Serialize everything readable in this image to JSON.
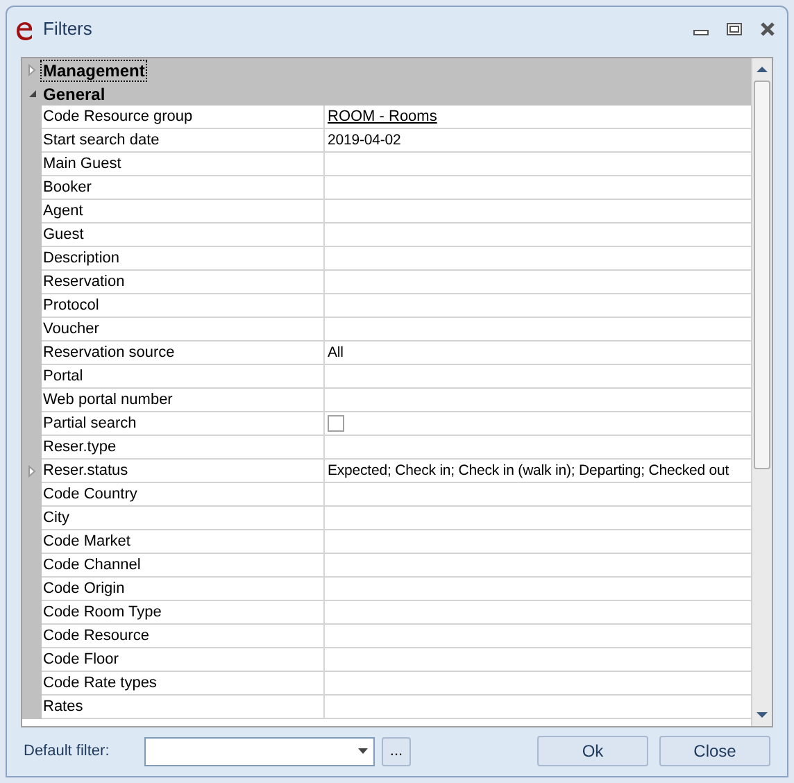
{
  "window": {
    "title": "Filters"
  },
  "groups": [
    {
      "label": "Management",
      "expanded": false,
      "focused": true
    },
    {
      "label": "General",
      "expanded": true,
      "focused": false
    }
  ],
  "rows": [
    {
      "label": "Code Resource group",
      "kind": "link",
      "value": "ROOM - Rooms"
    },
    {
      "label": "Start search date",
      "kind": "text",
      "value": "2019-04-02"
    },
    {
      "label": "Main Guest",
      "kind": "text"
    },
    {
      "label": "Booker",
      "kind": "text"
    },
    {
      "label": "Agent",
      "kind": "text"
    },
    {
      "label": "Guest",
      "kind": "text"
    },
    {
      "label": "Description",
      "kind": "text"
    },
    {
      "label": "Reservation",
      "kind": "text"
    },
    {
      "label": "Protocol",
      "kind": "text"
    },
    {
      "label": "Voucher",
      "kind": "text"
    },
    {
      "label": "Reservation source",
      "kind": "text",
      "value": "All"
    },
    {
      "label": "Portal",
      "kind": "text"
    },
    {
      "label": "Web portal number",
      "kind": "text"
    },
    {
      "label": "Partial search",
      "kind": "checkbox",
      "checked": false
    },
    {
      "label": "Reser.type",
      "kind": "text"
    },
    {
      "label": "Reser.status",
      "kind": "expander",
      "expanded": false,
      "value": "Expected; Check in; Check in (walk in); Departing; Checked out"
    },
    {
      "label": "Code Country",
      "kind": "text"
    },
    {
      "label": "City",
      "kind": "text"
    },
    {
      "label": "Code Market",
      "kind": "text"
    },
    {
      "label": "Code Channel",
      "kind": "text"
    },
    {
      "label": "Code Origin",
      "kind": "text"
    },
    {
      "label": "Code Room Type",
      "kind": "text"
    },
    {
      "label": "Code Resource",
      "kind": "text"
    },
    {
      "label": "Code Floor",
      "kind": "text"
    },
    {
      "label": "Code Rate types",
      "kind": "text"
    },
    {
      "label": "Rates",
      "kind": "text"
    }
  ],
  "footer": {
    "label": "Default filter:",
    "ellipsis": "...",
    "buttons": [
      "Ok",
      "Close"
    ]
  }
}
